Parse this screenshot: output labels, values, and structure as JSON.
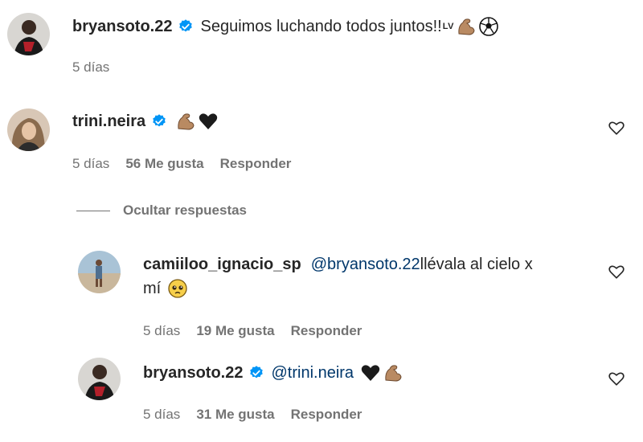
{
  "comments": {
    "main": {
      "username": "bryansoto.22",
      "text": "Seguimos luchando todos juntos!!",
      "suffix": "LV",
      "time": "5 días"
    },
    "trini": {
      "username": "trini.neira",
      "time": "5 días",
      "likes": "56 Me gusta",
      "reply_label": "Responder"
    },
    "hide_replies": "Ocultar respuestas",
    "reply1": {
      "username": "camiiloo_ignacio_sp",
      "mention": "@bryansoto.22",
      "text_line1": " llévala al cielo x",
      "text_line2": "mí",
      "time": "5 días",
      "likes": "19 Me gusta",
      "reply_label": "Responder"
    },
    "reply2": {
      "username": "bryansoto.22",
      "mention": "@trini.neira",
      "time": "5 días",
      "likes": "31 Me gusta",
      "reply_label": "Responder"
    }
  },
  "icons": {
    "verified": "verified-badge-icon",
    "heart": "heart-outline-icon",
    "flexed_biceps": "flexed-biceps-emoji",
    "black_heart": "black-heart-emoji",
    "soccer_ball": "soccer-ball-emoji",
    "pleading_face": "pleading-face-emoji"
  },
  "colors": {
    "verified_blue": "#0095f6",
    "mention": "#00376b",
    "secondary_text": "#737373"
  }
}
